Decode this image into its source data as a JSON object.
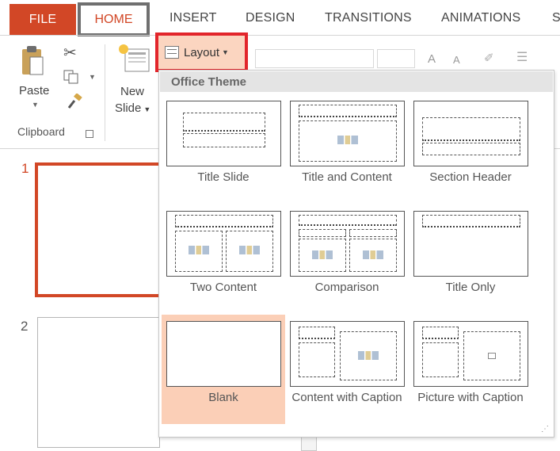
{
  "tabs": {
    "file": "FILE",
    "home": "HOME",
    "insert": "INSERT",
    "design": "DESIGN",
    "transitions": "TRANSITIONS",
    "animations": "ANIMATIONS",
    "partial": "S"
  },
  "ribbon": {
    "paste_label": "Paste",
    "clipboard_group": "Clipboard",
    "new_slide_line1": "New",
    "new_slide_line2": "Slide",
    "layout_label": "Layout",
    "grow_font": "A",
    "shrink_font": "A"
  },
  "slides": {
    "slide1_number": "1",
    "slide2_number": "2"
  },
  "gallery": {
    "theme_title": "Office Theme",
    "layouts": [
      {
        "label": "Title Slide",
        "selected": false
      },
      {
        "label": "Title and Content",
        "selected": false
      },
      {
        "label": "Section Header",
        "selected": false
      },
      {
        "label": "Two Content",
        "selected": false
      },
      {
        "label": "Comparison",
        "selected": false
      },
      {
        "label": "Title Only",
        "selected": false
      },
      {
        "label": "Blank",
        "selected": true
      },
      {
        "label": "Content with Caption",
        "selected": false
      },
      {
        "label": "Picture with Caption",
        "selected": false
      }
    ]
  },
  "colors": {
    "accent": "#d24726",
    "highlight_border": "#e2252b",
    "selected_bg": "#fbcfb7"
  }
}
